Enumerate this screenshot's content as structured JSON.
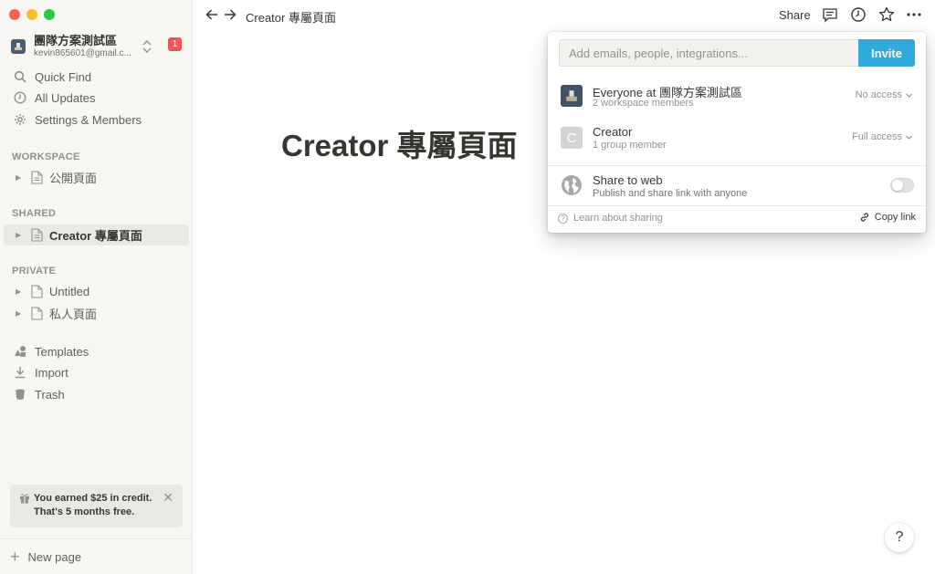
{
  "sidebar": {
    "workspace": {
      "name": "團隊方案測試區",
      "email": "kevin865601@gmail.c...",
      "badge_count": "1",
      "avatar_icon": "workspace-avatar-icon"
    },
    "nav": [
      {
        "label": "Quick Find",
        "icon": "search-icon"
      },
      {
        "label": "All Updates",
        "icon": "clock-icon"
      },
      {
        "label": "Settings & Members",
        "icon": "gear-icon"
      }
    ],
    "sections": {
      "workspace": "WORKSPACE",
      "shared": "SHARED",
      "private": "PRIVATE"
    },
    "workspace_pages": [
      {
        "label": "公開頁面"
      }
    ],
    "shared_pages": [
      {
        "label": "Creator 專屬頁面",
        "active": true
      }
    ],
    "private_pages": [
      {
        "label": "Untitled"
      },
      {
        "label": "私人頁面"
      }
    ],
    "tools": [
      {
        "label": "Templates",
        "icon": "templates-icon"
      },
      {
        "label": "Import",
        "icon": "import-icon"
      },
      {
        "label": "Trash",
        "icon": "trash-icon"
      }
    ],
    "credit": {
      "line1": "You earned $25 in credit.",
      "line2": "That's 5 months free.",
      "close": "✕"
    },
    "new_page": "New page"
  },
  "topbar": {
    "breadcrumb": "Creator 專屬頁面",
    "share": "Share"
  },
  "page": {
    "title": "Creator 專屬頁面"
  },
  "share_popover": {
    "invite_placeholder": "Add emails, people, integrations...",
    "invite_button": "Invite",
    "members": [
      {
        "name": "Everyone at 團隊方案測試區",
        "sub": "2 workspace members",
        "access": "No access"
      },
      {
        "name": "Creator",
        "sub": "1 group member",
        "access": "Full access",
        "avatar_letter": "C"
      }
    ],
    "web": {
      "title": "Share to web",
      "subtitle": "Publish and share link with anyone",
      "enabled": false
    },
    "learn": "Learn about sharing",
    "copy_link": "Copy link"
  },
  "help": "?",
  "colors": {
    "invite": "#2eaadc",
    "badge": "#eb5757",
    "sidebar_bg": "#f7f6f3"
  }
}
